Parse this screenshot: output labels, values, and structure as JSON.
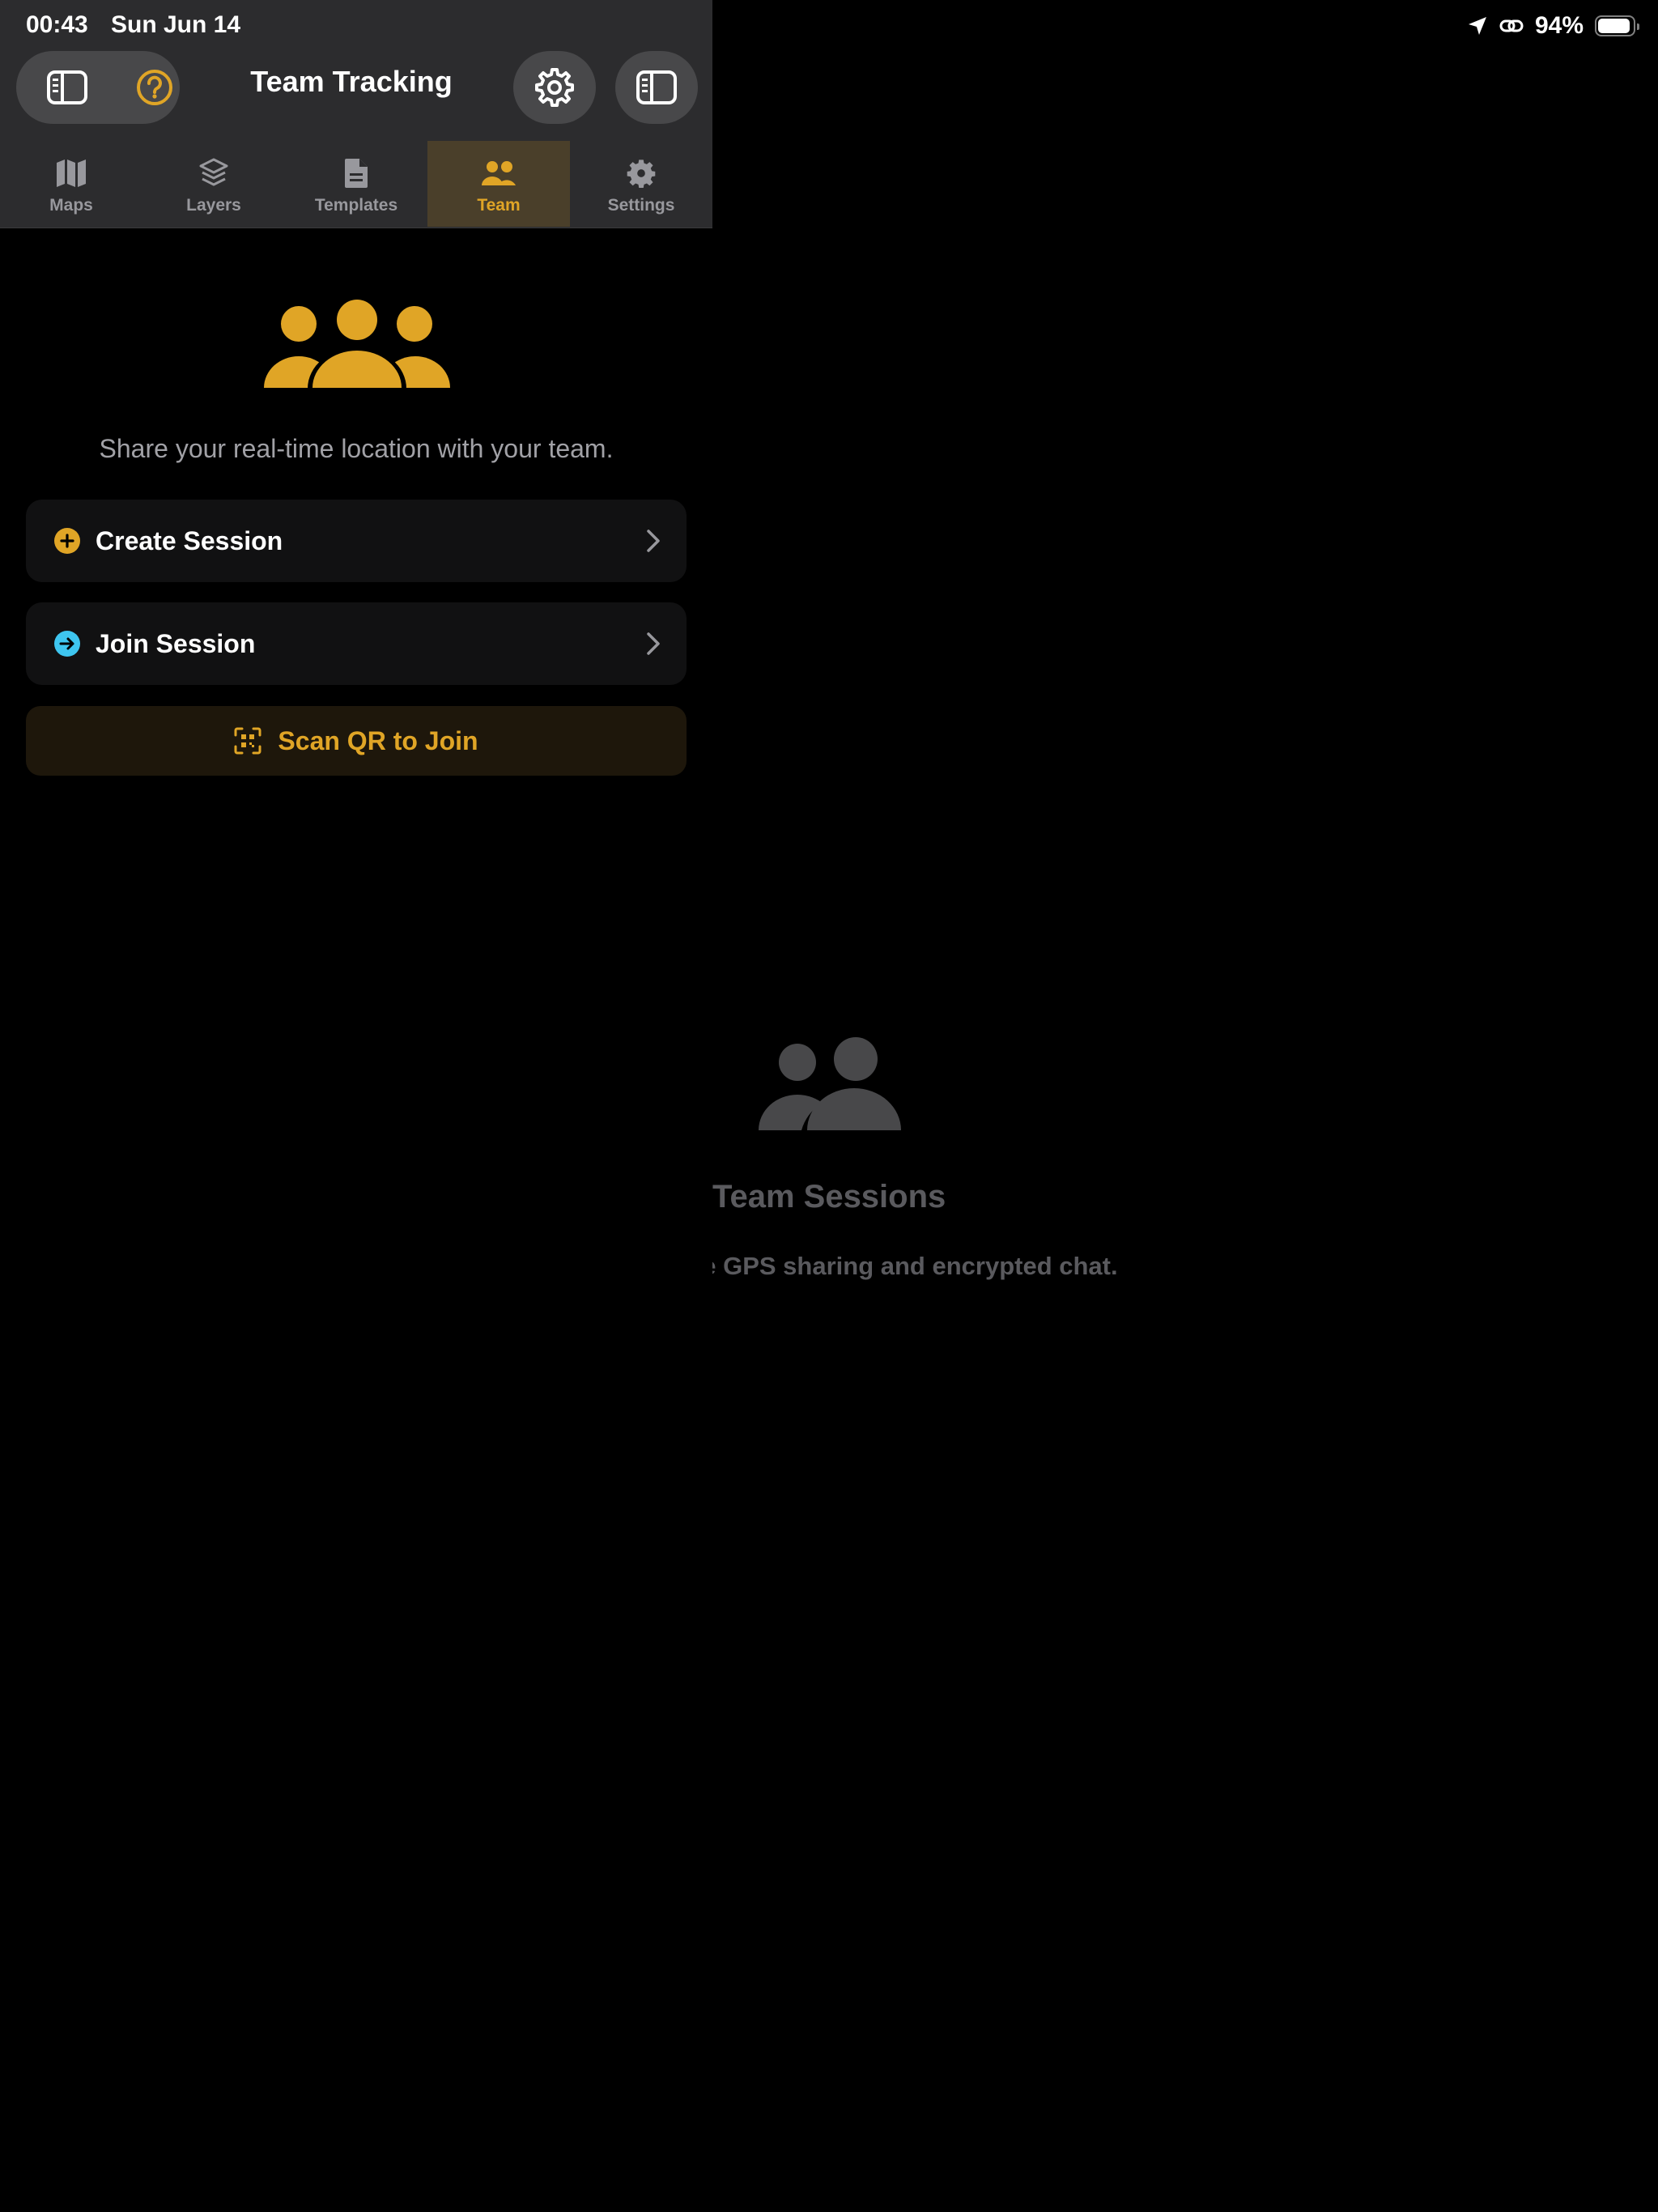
{
  "status_bar": {
    "time": "00:43",
    "date": "Sun Jun 14",
    "battery_percent": "94%",
    "battery_level": 0.94,
    "icons": [
      "location-arrow-icon",
      "link-icon",
      "battery-icon"
    ]
  },
  "header": {
    "title": "Team Tracking",
    "left_buttons": [
      "sidebar-toggle-icon",
      "help-icon"
    ],
    "right_buttons": [
      "gear-icon",
      "sidebar-toggle-icon"
    ]
  },
  "tabs": [
    {
      "label": "Maps",
      "icon": "map-icon",
      "active": false
    },
    {
      "label": "Layers",
      "icon": "layers-icon",
      "active": false
    },
    {
      "label": "Templates",
      "icon": "document-icon",
      "active": false
    },
    {
      "label": "Team",
      "icon": "team-icon",
      "active": true
    },
    {
      "label": "Settings",
      "icon": "gear-icon",
      "active": false
    }
  ],
  "team_panel": {
    "hero_icon": "team-icon",
    "tagline": "Share your real-time location with your team.",
    "actions": [
      {
        "label": "Create Session",
        "icon": "plus-circle-icon",
        "icon_color": "#e0a526"
      },
      {
        "label": "Join Session",
        "icon": "arrow-circle-icon",
        "icon_color": "#3ec6f0"
      }
    ],
    "scan_button": {
      "label": "Scan QR to Join",
      "icon": "qr-scan-icon"
    }
  },
  "detail": {
    "icon": "people-icon",
    "title": "Team Sessions",
    "subtitle": "ve GPS sharing and encrypted chat."
  },
  "colors": {
    "accent": "#e0a526",
    "join_accent": "#3ec6f0",
    "header_bg": "#2c2c2e",
    "muted_text": "#5a5a5e"
  }
}
